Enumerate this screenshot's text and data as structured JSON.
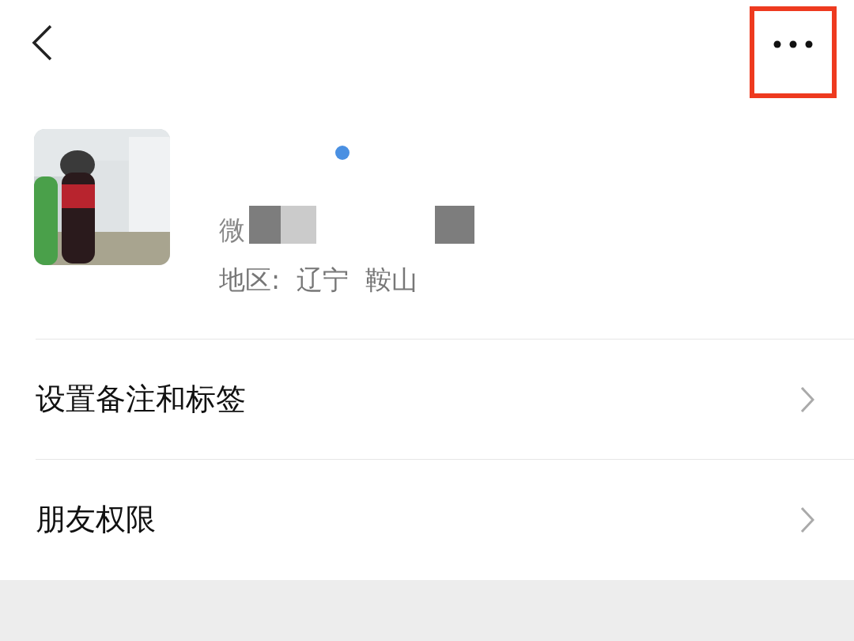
{
  "profile": {
    "wechat_id_prefix": "微",
    "region": "地区:  辽宁  鞍山"
  },
  "menu_items": [
    {
      "label": "设置备注和标签"
    },
    {
      "label": "朋友权限"
    }
  ]
}
